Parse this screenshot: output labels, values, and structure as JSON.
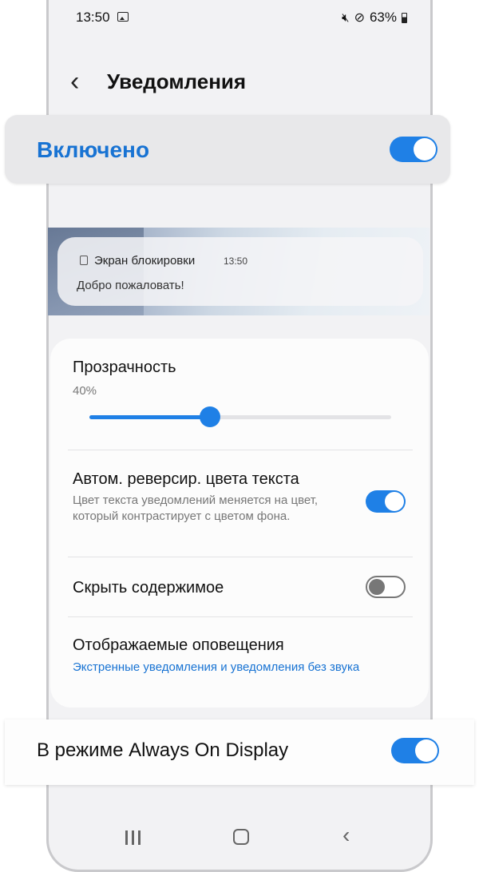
{
  "status_bar": {
    "time": "13:50",
    "battery": "63%"
  },
  "header": {
    "title": "Уведомления"
  },
  "enabled": {
    "label": "Включено",
    "on": true
  },
  "preview": {
    "app": "Экран блокировки",
    "time": "13:50",
    "message": "Добро пожаловать!"
  },
  "transparency": {
    "label": "Прозрачность",
    "value": "40%",
    "level": 0.4
  },
  "auto_reverse": {
    "label": "Автом. реверсир. цвета текста",
    "description": "Цвет текста уведомлений меняется на цвет, который контрастирует с цветом фона.",
    "on": true
  },
  "hide_content": {
    "label": "Скрыть содержимое",
    "on": false
  },
  "alerts": {
    "label": "Отображаемые оповещения",
    "value": "Экстренные уведомления и уведомления без звука"
  },
  "aod": {
    "label": "В режиме Always On Display",
    "on": true
  },
  "colors": {
    "accent": "#1f80e6",
    "accent_text": "#1873d3"
  }
}
